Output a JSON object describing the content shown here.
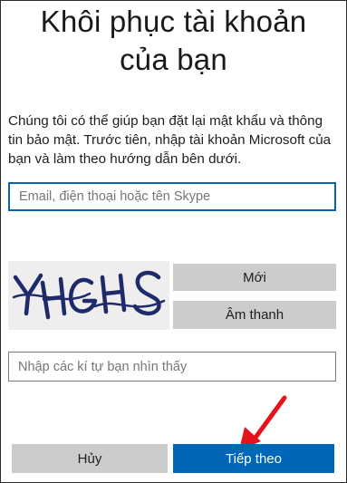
{
  "title_line1": "Khôi phục tài khoản",
  "title_line2": "của bạn",
  "description": "Chúng tôi có thể giúp bạn đặt lại mật khẩu và thông tin bảo mật. Trước tiên, nhập tài khoản Microsoft của bạn và làm theo hướng dẫn bên dưới.",
  "email_input": {
    "value": "",
    "placeholder": "Email, điện thoại hoặc tên Skype"
  },
  "captcha": {
    "image_text": "YHGHS",
    "new_button": "Mới",
    "audio_button": "Âm thanh",
    "input_placeholder": "Nhập các kí tự bạn nhìn thấy",
    "input_value": ""
  },
  "buttons": {
    "cancel": "Hủy",
    "next": "Tiếp theo"
  },
  "colors": {
    "primary": "#0067b8",
    "secondary_button": "#cccccc",
    "captcha_ink": "#1f2a6b",
    "annotation_arrow": "#e3141b"
  },
  "icons": {
    "annotation": "red-arrow-icon"
  }
}
